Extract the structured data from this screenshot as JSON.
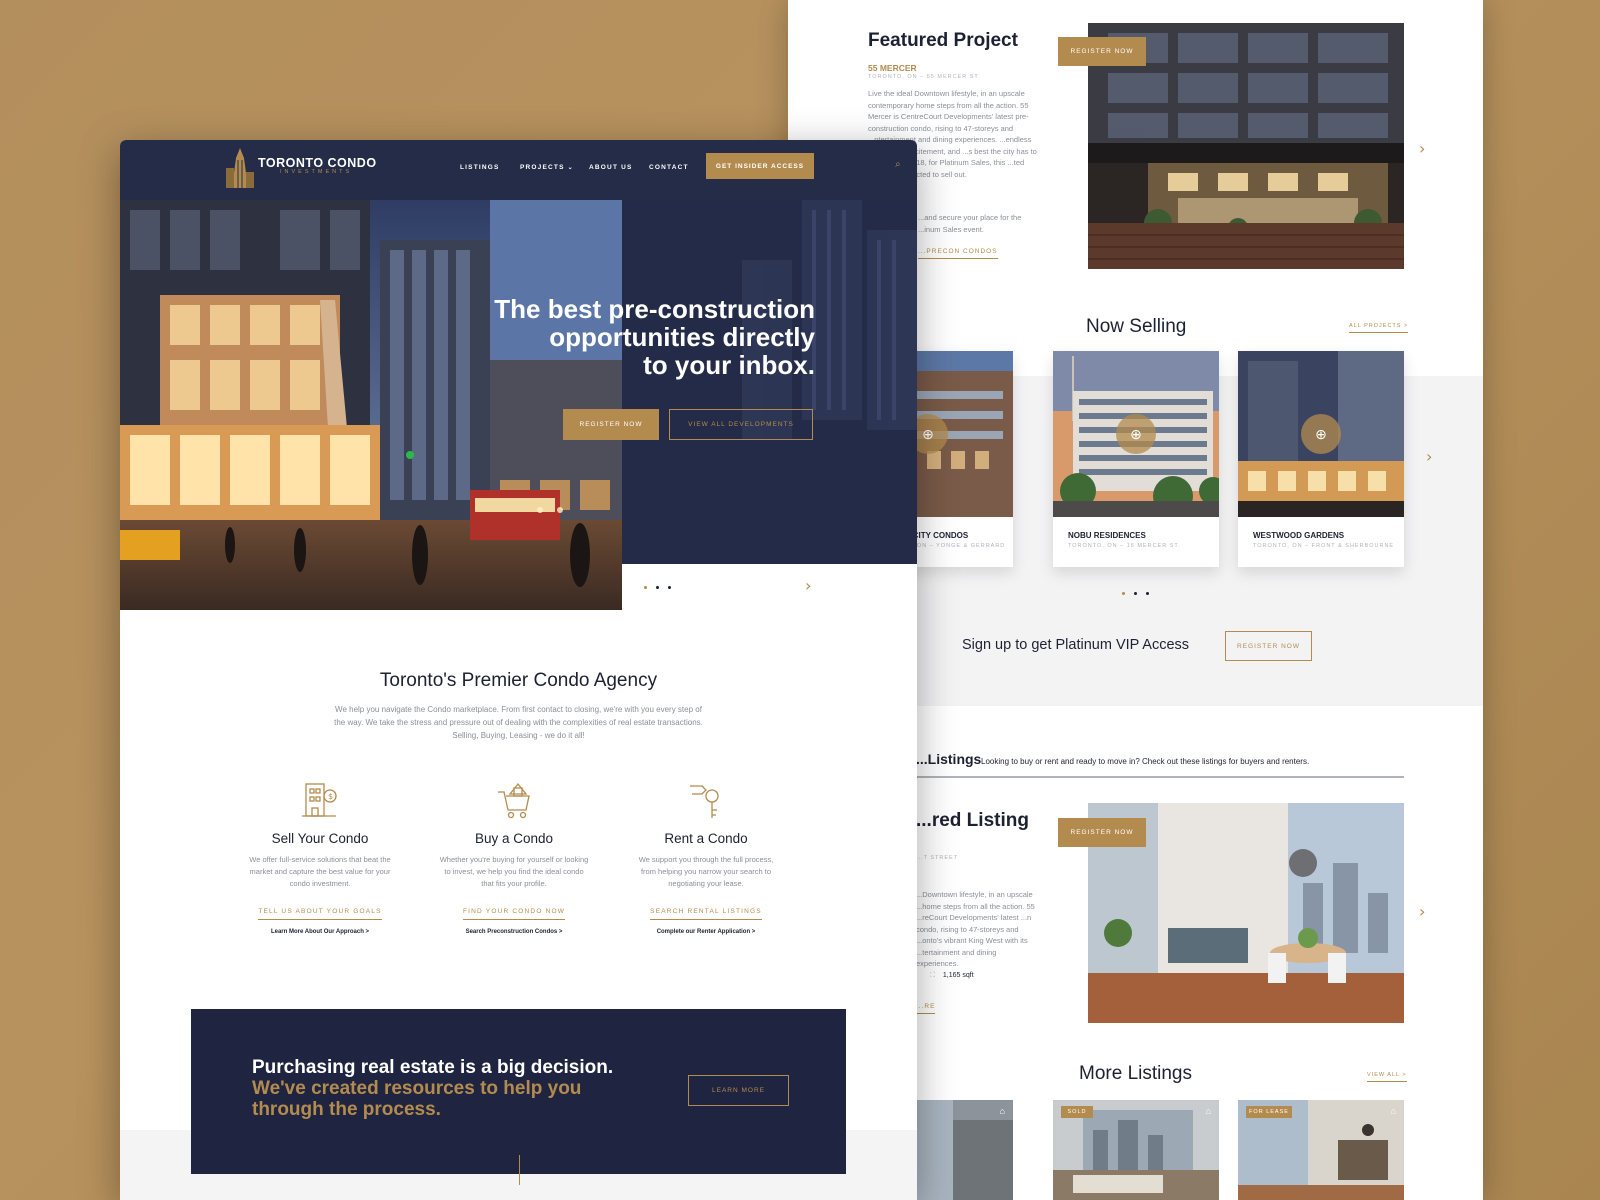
{
  "featured": {
    "title": "Featured Project",
    "name": "55 MERCER",
    "location": "TORONTO, ON – 55 MERCER ST",
    "description": "Live the ideal Downtown lifestyle, in an upscale contemporary home steps from all the action. 55 Mercer is CentreCourt Developments' latest pre-construction condo, rising to 47-storeys and ...ntertainment and dining experiences. ...endless culture and excitement, and ...s best the city has to offer. ...bruary 18, for Platinum Sales, this ...ted project is expected to sell out.",
    "description2": "...and secure your place for the ...inum Sales event.",
    "link": "...PRECON CONDOS",
    "register": "REGISTER NOW"
  },
  "now_selling": {
    "title": "Now Selling",
    "all_link": "ALL PROJECTS >",
    "cards": [
      {
        "name": "...T CITY CONDOS",
        "sub": "...O, ON – YONGE & GERRARD"
      },
      {
        "name": "NOBU RESIDENCES",
        "sub": "TORONTO, ON – 15 MERCER ST."
      },
      {
        "name": "WESTWOOD GARDENS",
        "sub": "TORONTO, ON – FRONT & SHERBOURNE"
      }
    ]
  },
  "vip": {
    "text": "Sign up to get Platinum VIP Access",
    "button": "REGISTER NOW"
  },
  "listings": {
    "title": "...Listings",
    "tagline": "Looking to buy or rent and ready to move in? Check out these listings for buyers and renters.",
    "featured_title": "...red Listing",
    "street": "...T STREET",
    "description": "...Downtown lifestyle, in an upscale ...home steps from all the action. 55 ...reCourt Developments' latest ...n condo, rising to 47-storeys and ...onto's vibrant King West with its ...tertainment and dining experiences.",
    "sqft": "1,165 sqft",
    "more_link": "...RE",
    "register": "REGISTER NOW"
  },
  "more_listings": {
    "title": "More Listings",
    "view_all": "VIEW ALL >",
    "badges": [
      "SOLD",
      "FOR LEASE"
    ]
  },
  "nav": {
    "logo_main": "TORONTO CONDO",
    "logo_sub": "INVESTMENTS",
    "items": [
      "LISTINGS",
      "PROJECTS",
      "ABOUT US",
      "CONTACT"
    ],
    "cta": "GET INSIDER ACCESS"
  },
  "hero": {
    "line1": "The best pre-construction",
    "line2": "opportunities directly",
    "line3": "to your inbox.",
    "register": "REGISTER NOW",
    "view_all": "VIEW ALL DEVELOPMENTS"
  },
  "agency": {
    "title": "Toronto's Premier Condo Agency",
    "text1": "We help you navigate the Condo marketplace. From first contact to closing, we're with you every step of",
    "text2": "the way. We take the stress and pressure out of dealing with the complexities of real estate transactions.",
    "text3": "Selling, Buying, Leasing - we do it all!"
  },
  "services": [
    {
      "title": "Sell Your Condo",
      "text": "We offer full-service solutions that beat the market and capture the best value for your condo investment.",
      "link": "TELL US ABOUT YOUR GOALS",
      "small": "Learn More About Our Approach >"
    },
    {
      "title": "Buy a Condo",
      "text": "Whether you're buying for yourself or looking to invest, we help you find the ideal condo that fits your profile.",
      "link": "FIND YOUR CONDO NOW",
      "small": "Search Preconstruction Condos >"
    },
    {
      "title": "Rent a Condo",
      "text": "We support you through the full process, from helping you narrow your search to negotiating your lease.",
      "link": "SEARCH RENTAL LISTINGS",
      "small": "Complete our Renter Application >"
    }
  ],
  "cta": {
    "line1": "Purchasing real estate is a big decision.",
    "line2": "We've created resources to help you",
    "line3": "through the process.",
    "button": "LEARN MORE"
  },
  "colors": {
    "navy": "#242c48",
    "gold": "#b38b4e",
    "background": "#b38f5d"
  }
}
